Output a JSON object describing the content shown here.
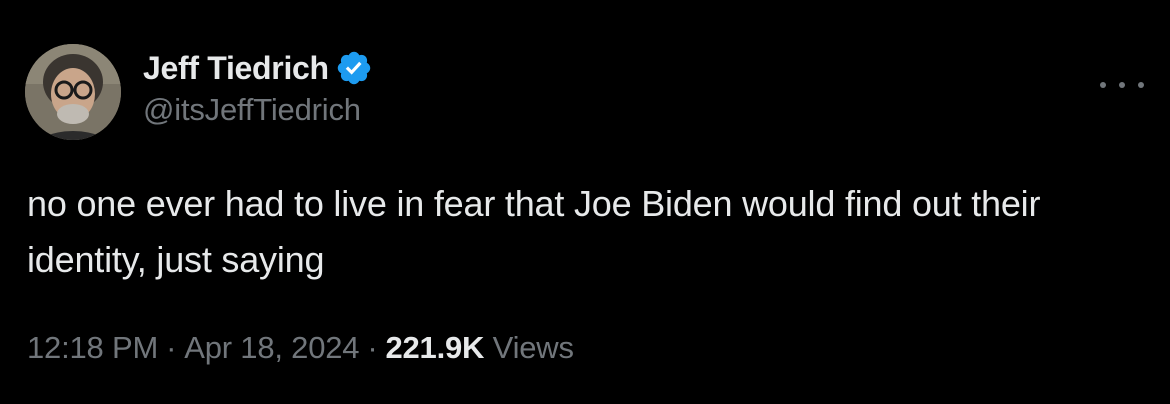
{
  "author": {
    "display_name": "Jeff Tiedrich",
    "handle": "@itsJeffTiedrich",
    "verified": true
  },
  "tweet": {
    "text": "no one ever had to live in fear that Joe Biden would find out their identity, just saying",
    "time": "12:18 PM",
    "date": "Apr 18, 2024",
    "separator": "·",
    "views_count": "221.9K",
    "views_label": "Views"
  },
  "icons": {
    "verified": "verified-badge-icon",
    "more": "more-horizontal-icon"
  },
  "colors": {
    "background": "#000000",
    "text_primary": "#e7e9ea",
    "text_secondary": "#71767b",
    "verified_blue": "#1d9bf0"
  }
}
